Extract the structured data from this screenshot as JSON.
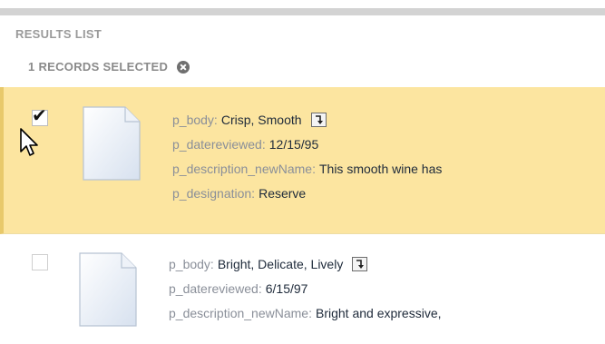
{
  "header": {
    "section_title": "RESULTS LIST",
    "selection_count_text": "1 RECORDS SELECTED"
  },
  "colors": {
    "selected_row_bg": "#fce5a0",
    "selected_row_border": "#e8c96b",
    "field_key": "#8a8f99",
    "field_value": "#1e2a3a"
  },
  "results": [
    {
      "selected": true,
      "icon": "document-icon",
      "fields": [
        {
          "key": "p_body:",
          "value": "Crisp, Smooth",
          "has_expand": true
        },
        {
          "key": "p_datereviewed:",
          "value": "12/15/95"
        },
        {
          "key": "p_description_newName:",
          "value": "This smooth wine has"
        },
        {
          "key": "p_designation:",
          "value": "Reserve"
        }
      ]
    },
    {
      "selected": false,
      "icon": "document-icon",
      "fields": [
        {
          "key": "p_body:",
          "value": "Bright, Delicate, Lively",
          "has_expand": true
        },
        {
          "key": "p_datereviewed:",
          "value": "6/15/97"
        },
        {
          "key": "p_description_newName:",
          "value": "Bright and expressive,"
        }
      ]
    }
  ]
}
